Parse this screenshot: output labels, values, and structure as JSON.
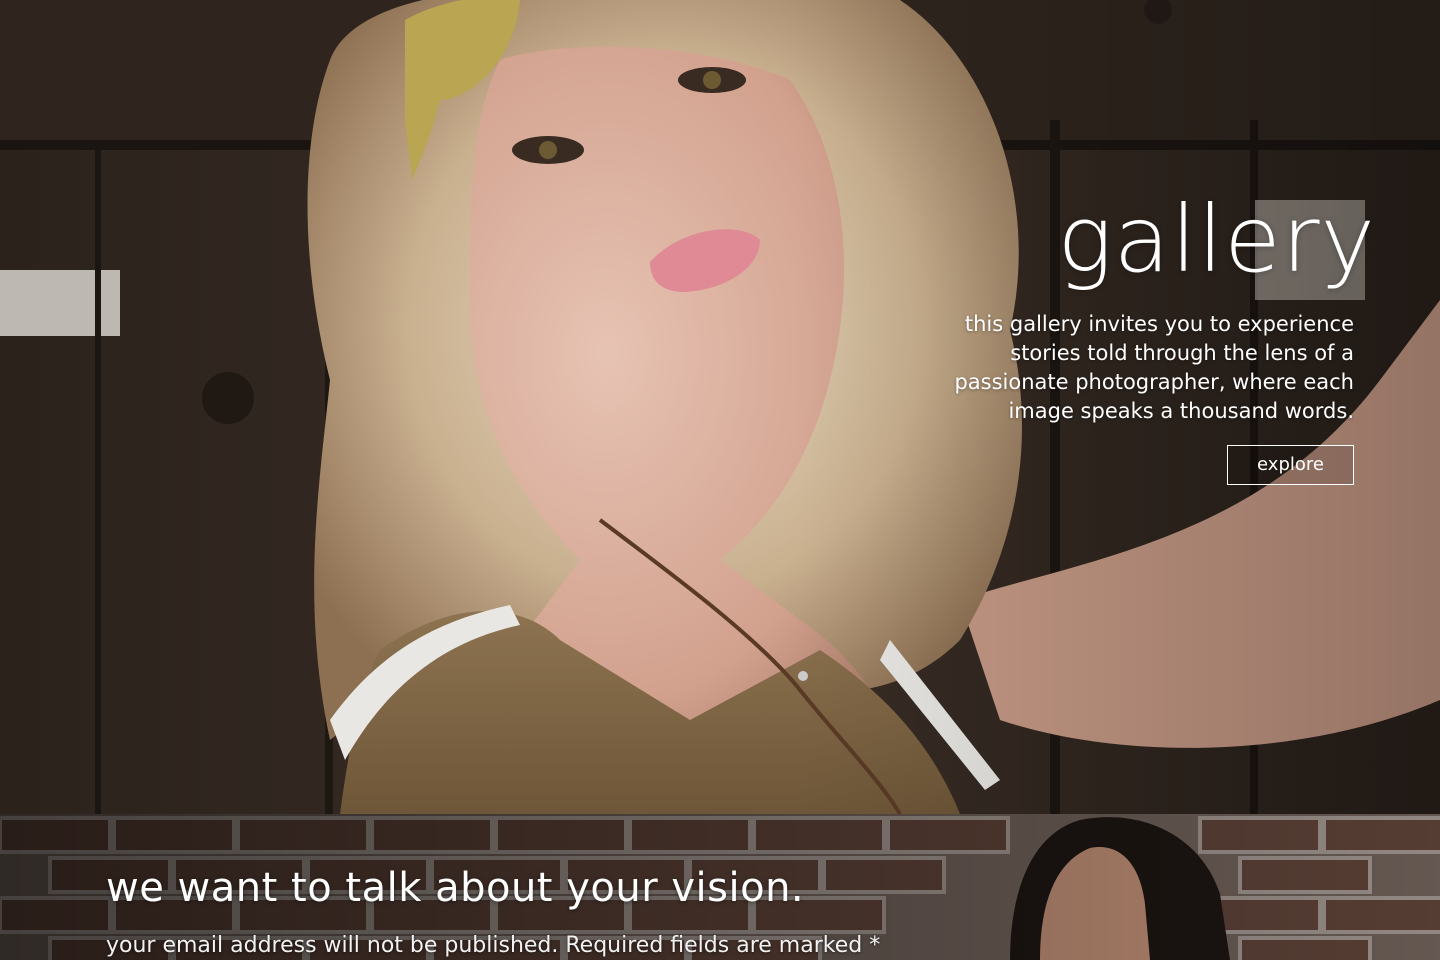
{
  "hero": {
    "title": "gallery",
    "description": "this gallery invites you to experience stories told through the lens of a passionate photographer, where each image speaks a thousand words.",
    "button_label": "explore"
  },
  "contact": {
    "title": "we want to talk about your vision.",
    "note": "your email address will not be published. Required fields are marked *"
  },
  "colors": {
    "text": "#ffffff",
    "wood_dark": "#2e241d",
    "brick": "#5a4036"
  }
}
